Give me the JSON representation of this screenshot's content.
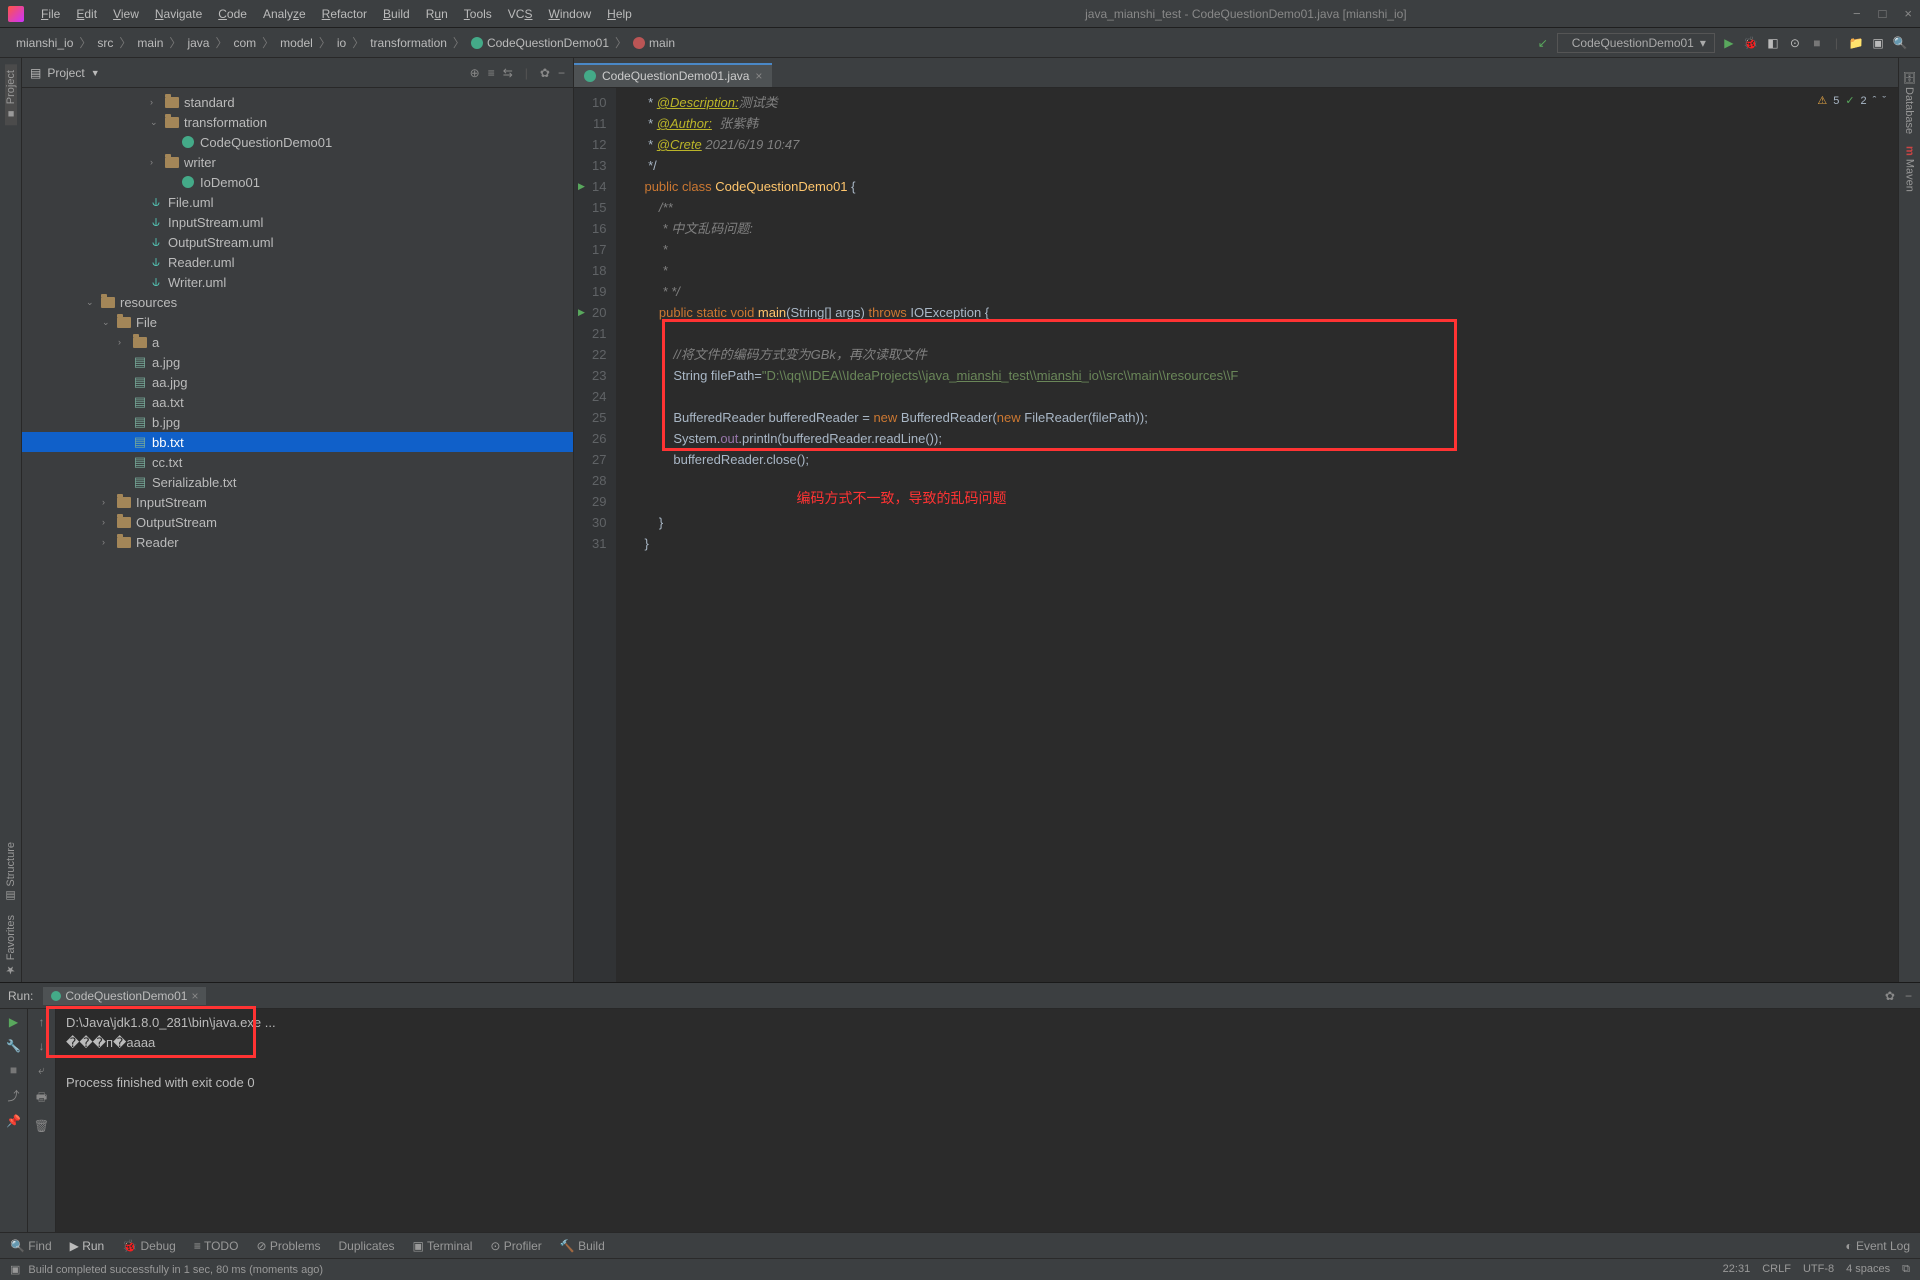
{
  "title": "java_mianshi_test - CodeQuestionDemo01.java [mianshi_io]",
  "menu": [
    "File",
    "Edit",
    "View",
    "Navigate",
    "Code",
    "Analyze",
    "Refactor",
    "Build",
    "Run",
    "Tools",
    "VCS",
    "Window",
    "Help"
  ],
  "win": {
    "min": "−",
    "max": "□",
    "close": "×"
  },
  "breadcrumbs": [
    "mianshi_io",
    "src",
    "main",
    "java",
    "com",
    "model",
    "io",
    "transformation",
    "CodeQuestionDemo01",
    "main"
  ],
  "nav": {
    "refresh": "↺",
    "config": "CodeQuestionDemo01",
    "run": "▶",
    "debug": "🐞",
    "cov": "◧",
    "stop": "■"
  },
  "left_strip": [
    "Project",
    "Structure",
    "Favorites"
  ],
  "right_strip": [
    "Database",
    "Maven"
  ],
  "project": {
    "label": "Project",
    "tree": [
      {
        "ind": 8,
        "exp": ">",
        "icon": "folder",
        "name": "standard"
      },
      {
        "ind": 8,
        "exp": "v",
        "icon": "folder",
        "name": "transformation"
      },
      {
        "ind": 9,
        "exp": "",
        "icon": "class",
        "name": "CodeQuestionDemo01"
      },
      {
        "ind": 8,
        "exp": ">",
        "icon": "folder",
        "name": "writer"
      },
      {
        "ind": 9,
        "exp": "",
        "icon": "class",
        "name": "IoDemo01"
      },
      {
        "ind": 7,
        "exp": "",
        "icon": "uml",
        "name": "File.uml"
      },
      {
        "ind": 7,
        "exp": "",
        "icon": "uml",
        "name": "InputStream.uml"
      },
      {
        "ind": 7,
        "exp": "",
        "icon": "uml",
        "name": "OutputStream.uml"
      },
      {
        "ind": 7,
        "exp": "",
        "icon": "uml",
        "name": "Reader.uml"
      },
      {
        "ind": 7,
        "exp": "",
        "icon": "uml",
        "name": "Writer.uml"
      },
      {
        "ind": 4,
        "exp": "v",
        "icon": "folder",
        "name": "resources"
      },
      {
        "ind": 5,
        "exp": "v",
        "icon": "folder",
        "name": "File"
      },
      {
        "ind": 6,
        "exp": ">",
        "icon": "folder",
        "name": "a"
      },
      {
        "ind": 6,
        "exp": "",
        "icon": "file",
        "name": "a.jpg"
      },
      {
        "ind": 6,
        "exp": "",
        "icon": "file",
        "name": "aa.jpg"
      },
      {
        "ind": 6,
        "exp": "",
        "icon": "file",
        "name": "aa.txt"
      },
      {
        "ind": 6,
        "exp": "",
        "icon": "file",
        "name": "b.jpg"
      },
      {
        "ind": 6,
        "exp": "",
        "icon": "file",
        "name": "bb.txt",
        "sel": true
      },
      {
        "ind": 6,
        "exp": "",
        "icon": "file",
        "name": "cc.txt"
      },
      {
        "ind": 6,
        "exp": "",
        "icon": "file",
        "name": "Serializable.txt"
      },
      {
        "ind": 5,
        "exp": ">",
        "icon": "folder",
        "name": "InputStream"
      },
      {
        "ind": 5,
        "exp": ">",
        "icon": "folder",
        "name": "OutputStream"
      },
      {
        "ind": 5,
        "exp": ">",
        "icon": "folder",
        "name": "Reader"
      }
    ]
  },
  "editor": {
    "tab": "CodeQuestionDemo01.java",
    "warn": "5",
    "ok": "2",
    "lines": [
      {
        "n": 10,
        "html": " * <span class='an'>@Description:</span><span class='c'>测试类</span>"
      },
      {
        "n": 11,
        "html": " * <span class='an'>@Author:</span>  <span class='c'>张紫韩</span>"
      },
      {
        "n": 12,
        "html": " * <span class='an'>@Crete</span> <span class='c'>2021/6/19 10:47</span>"
      },
      {
        "n": 13,
        "html": " */"
      },
      {
        "n": 14,
        "run": true,
        "html": "<span class='k'>public class </span><span class='id'>CodeQuestionDemo01 </span>{"
      },
      {
        "n": 15,
        "html": "    <span class='c'>/**</span>"
      },
      {
        "n": 16,
        "html": "     <span class='c'>* 中文乱码问题:</span>"
      },
      {
        "n": 17,
        "html": "     <span class='c'>*</span>"
      },
      {
        "n": 18,
        "html": "     <span class='c'>*</span>"
      },
      {
        "n": 19,
        "html": "     <span class='c'>* */</span>"
      },
      {
        "n": 20,
        "run": true,
        "html": "    <span class='k'>public static void </span><span class='id'>main</span>(String[] args) <span class='k'>throws </span>IOException {"
      },
      {
        "n": 21,
        "html": ""
      },
      {
        "n": 22,
        "html": "        <span class='c'>//将文件的编码方式变为GBk，再次读取文件</span>"
      },
      {
        "n": 23,
        "html": "        String filePath=<span class='s'>\"D:\\\\qq\\\\IDEA\\\\IdeaProjects\\\\java_<u>mianshi</u>_test\\\\<u>mianshi</u>_io\\\\src\\\\main\\\\resources\\\\F</span>"
      },
      {
        "n": 24,
        "html": ""
      },
      {
        "n": 25,
        "html": "        BufferedReader bufferedReader = <span class='k'>new </span>BufferedReader(<span class='k'>new </span>FileReader(filePath));"
      },
      {
        "n": 26,
        "html": "        System.<span class='fld'>out</span>.println(bufferedReader.readLine());"
      },
      {
        "n": 27,
        "html": "        bufferedReader.close();"
      },
      {
        "n": 28,
        "html": ""
      },
      {
        "n": 29,
        "html": ""
      },
      {
        "n": 30,
        "html": "    }"
      },
      {
        "n": 31,
        "html": "}"
      }
    ],
    "annotation": "编码方式不一致，导致的乱码问题"
  },
  "run": {
    "label": "Run:",
    "tab": "CodeQuestionDemo01",
    "out": [
      "D:\\Java\\jdk1.8.0_281\\bin\\java.exe ...",
      "���п�aaaa",
      "",
      "Process finished with exit code 0"
    ]
  },
  "bottom": {
    "items": [
      "Find",
      "Run",
      "Debug",
      "TODO",
      "Problems",
      "Duplicates",
      "Terminal",
      "Profiler",
      "Build"
    ],
    "event": "Event Log"
  },
  "status": {
    "msg": "Build completed successfully in 1 sec, 80 ms (moments ago)",
    "right": [
      "22:31",
      "CRLF",
      "UTF-8",
      "4 spaces",
      "⧉"
    ]
  }
}
